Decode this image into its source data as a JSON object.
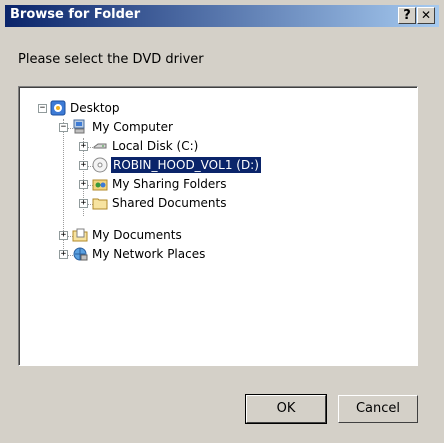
{
  "window": {
    "title": "Browse for Folder",
    "help_glyph": "?",
    "close_glyph": "✕"
  },
  "prompt": "Please select the DVD driver",
  "tree": {
    "desktop": "Desktop",
    "my_computer": "My Computer",
    "local_disk": "Local Disk (C:)",
    "dvd_drive": "ROBIN_HOOD_VOL1 (D:)",
    "sharing_folders": "My Sharing Folders",
    "shared_documents": "Shared Documents",
    "my_documents": "My Documents",
    "network_places": "My Network Places",
    "expand_glyph": "+",
    "collapse_glyph": "−"
  },
  "buttons": {
    "ok": "OK",
    "cancel": "Cancel"
  },
  "colors": {
    "titlebar_start": "#0a246a",
    "titlebar_end": "#a6caf0",
    "selection": "#0a246a"
  }
}
